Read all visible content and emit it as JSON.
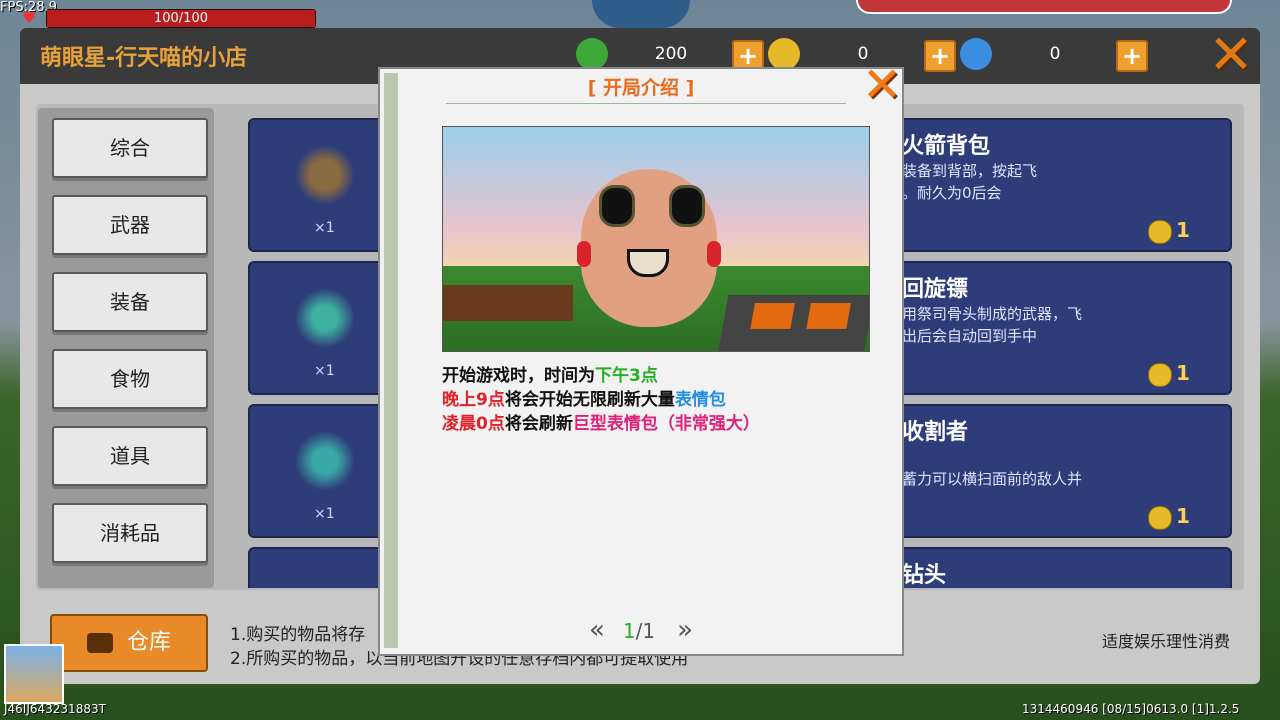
{
  "hud": {
    "fps": "FPS:28.9",
    "hp": "100/100",
    "hp_fraction": 1.0
  },
  "shop": {
    "title": "萌眼星-行天喵的小店",
    "currencies": [
      {
        "icon": "green-gem-coin-icon",
        "value": "200",
        "color": "#3fa63a"
      },
      {
        "icon": "gold-coin-icon",
        "value": "0",
        "color": "#e6b92a"
      },
      {
        "icon": "blue-m-coin-icon",
        "value": "0",
        "color": "#3c8ee0"
      }
    ],
    "categories": [
      "综合",
      "武器",
      "装备",
      "食物",
      "道具",
      "消耗品"
    ],
    "items": [
      {
        "name": "火箭背包",
        "desc_a": "装备到背部，按",
        "desc_b": "起飞",
        "desc_c": "。耐久为0后会",
        "desc_d": "",
        "qty": "×1",
        "price": "1"
      },
      {
        "name": "回旋镖",
        "desc_a": "用祭司骨头制成的武器，飞",
        "desc_b": "",
        "desc_c": "出后会自动回到手中",
        "desc_d": "",
        "qty": "×1",
        "price": "1"
      },
      {
        "name": "收割者",
        "desc_a": "",
        "desc_b": "",
        "desc_c": "蓄力可以横扫面前的敌人并",
        "desc_d": "",
        "qty": "×1",
        "price": "1"
      },
      {
        "name": "钻头",
        "desc_a": "",
        "desc_b": "",
        "desc_c": "",
        "desc_d": "",
        "qty": "",
        "price": ""
      }
    ],
    "warehouse": "仓库",
    "tip1": "1.购买的物品将存",
    "tip2": "2.所购买的物品，以当前地图开设的任意存档内都可提取使用",
    "moderate": "适度娱乐理性消费"
  },
  "footer": {
    "uid_left": "J46IJ643231883T",
    "uid_right": "1314460946    [08/15]0613.0    [1]1.2.5"
  },
  "modal": {
    "title": "[ 开局介绍 ]",
    "line1_a": "开始游戏时，时间为",
    "line1_b": "下午3点",
    "line2_a": "晚上9点",
    "line2_b": "将会开始无限刷新大量",
    "line2_c": "表情包",
    "line3_a": "凌晨0点",
    "line3_b": "将会刷新",
    "line3_c": "巨型表情包（非常强大）",
    "page_current": "1",
    "page_sep": "/1",
    "prev": "«",
    "next": "»"
  }
}
